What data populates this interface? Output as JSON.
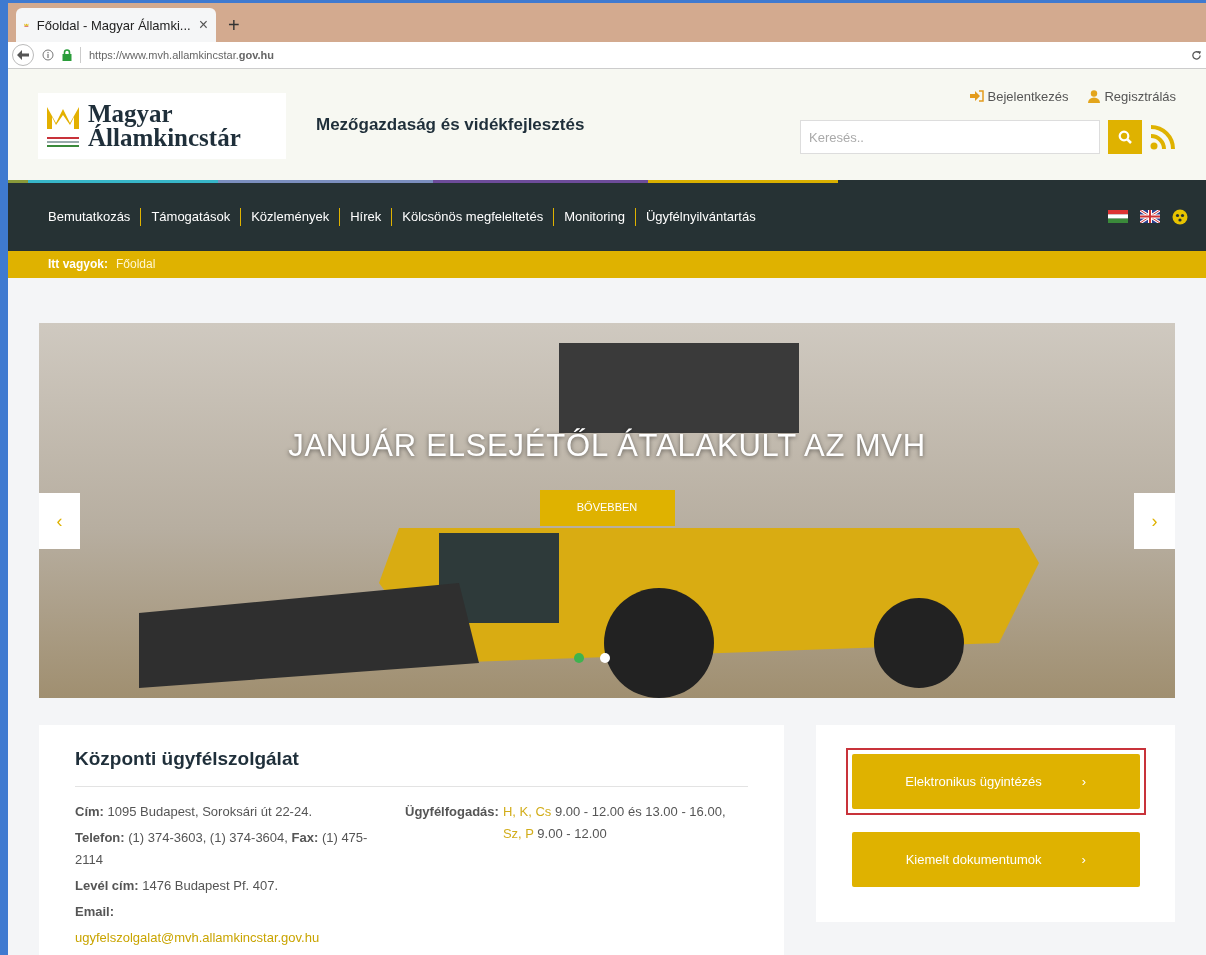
{
  "browser": {
    "tab": {
      "title": "Főoldal - Magyar Államki...",
      "close": "×"
    },
    "new_tab": "+",
    "url": "https://www.mvh.allamkincstar.**gov.hu**"
  },
  "header": {
    "logo": [
      "Magyar",
      "Államkincstár"
    ],
    "tagline": "Mezőgazdaság és vidékfejlesztés",
    "links": [
      {
        "kind": "login",
        "label": "Bejelentkezés"
      },
      {
        "kind": "register",
        "label": "Regisztrálás"
      }
    ],
    "search": {
      "placeholder": "Keresés.."
    }
  },
  "nav": {
    "items": [
      "Bemutatkozás",
      "Támogatások",
      "Közlemények",
      "Hírek",
      "Kölcsönös megfeleltetés",
      "Monitoring",
      "Ügyfélnyilvántartás"
    ]
  },
  "breadcrumb": {
    "label": "Itt vagyok:",
    "current": "Főoldal"
  },
  "slider": {
    "headline": "JANUÁR ELSEJÉTŐL ÁTALAKULT AZ MVH",
    "button": "BŐVEBBEN",
    "prev": "‹",
    "next": "›",
    "dots": [
      {
        "selected": true
      },
      {
        "selected": false
      }
    ]
  },
  "contact": {
    "title": "Központi ügyfélszolgálat",
    "lines": [
      "**Cím:** 1095 Budapest, Soroksári út 22-24.",
      "**Telefon:** (1) 374-3603, (1) 374-3604, **Fax:** (1) 475-2114",
      "**Levél cím:** 1476 Budapest Pf. 407.",
      "**Email:**"
    ],
    "email": "ugyfelszolgalat@mvh.allamkincstar.gov.hu",
    "hours": {
      "label": "Ügyfélfogadás:",
      "segments": [
        {
          "text": "H, K, Cs",
          "highlight": true
        },
        {
          "text": " 9.00 - 12.00 és 13.00 - 16.00, ",
          "highlight": false
        },
        {
          "text": "Sz, P",
          "highlight": true
        },
        {
          "text": " 9.00 - 12.00",
          "highlight": false
        }
      ]
    }
  },
  "quick_links": [
    {
      "label": "Elektronikus ügyintézés",
      "arrow": "›",
      "highlighted": true
    },
    {
      "label": "Kiemelt dokumentumok",
      "arrow": "›",
      "highlighted": false
    }
  ]
}
